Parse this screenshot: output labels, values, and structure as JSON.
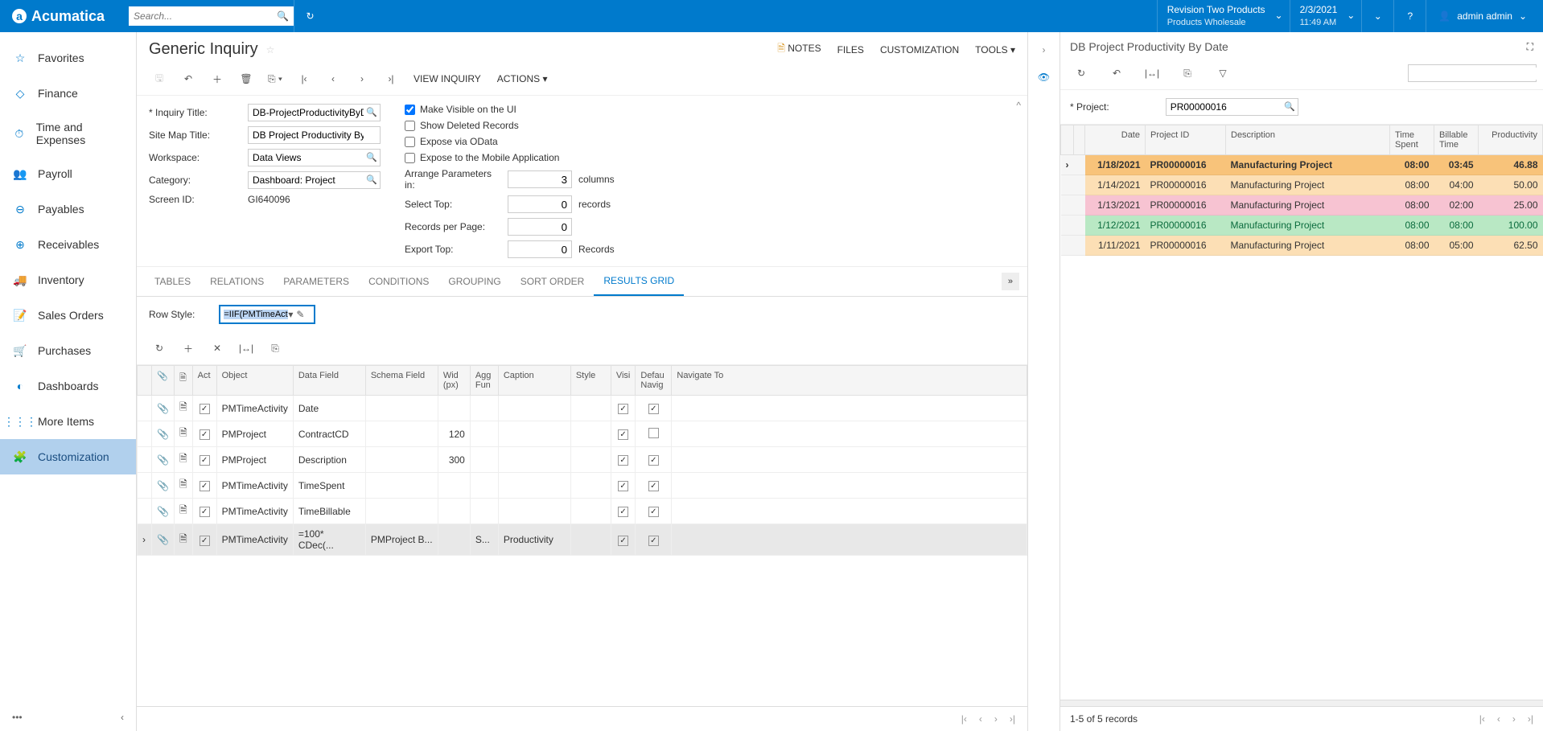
{
  "topbar": {
    "brand": "Acumatica",
    "search_placeholder": "Search...",
    "company_line1": "Revision Two Products",
    "company_line2": "Products Wholesale",
    "date": "2/3/2021",
    "time": "11:49 AM",
    "user": "admin admin"
  },
  "sidebar": {
    "items": [
      {
        "label": "Favorites",
        "icon": "star"
      },
      {
        "label": "Finance",
        "icon": "diamond"
      },
      {
        "label": "Time and Expenses",
        "icon": "stopwatch"
      },
      {
        "label": "Payroll",
        "icon": "people"
      },
      {
        "label": "Payables",
        "icon": "minus-circle"
      },
      {
        "label": "Receivables",
        "icon": "plus-circle"
      },
      {
        "label": "Inventory",
        "icon": "truck"
      },
      {
        "label": "Sales Orders",
        "icon": "note"
      },
      {
        "label": "Purchases",
        "icon": "cart"
      },
      {
        "label": "Dashboards",
        "icon": "gauge"
      },
      {
        "label": "More Items",
        "icon": "grid"
      },
      {
        "label": "Customization",
        "icon": "puzzle"
      }
    ]
  },
  "page": {
    "title": "Generic Inquiry",
    "actions": {
      "notes": "NOTES",
      "files": "FILES",
      "customization": "CUSTOMIZATION",
      "tools": "TOOLS"
    },
    "toolbar": {
      "viewinquiry": "VIEW INQUIRY",
      "actions": "ACTIONS"
    }
  },
  "form": {
    "inquiry_title_label": "Inquiry Title:",
    "inquiry_title": "DB-ProjectProductivityByDate",
    "sitemap_label": "Site Map Title:",
    "sitemap": "DB Project Productivity By Date",
    "workspace_label": "Workspace:",
    "workspace": "Data Views",
    "category_label": "Category:",
    "category": "Dashboard: Project",
    "screen_label": "Screen ID:",
    "screen": "GI640096",
    "chk_ui": "Make Visible on the UI",
    "chk_deleted": "Show Deleted Records",
    "chk_odata": "Expose via OData",
    "chk_mobile": "Expose to the Mobile Application",
    "arrange_label": "Arrange Parameters in:",
    "arrange_val": "3",
    "arrange_unit": "columns",
    "selecttop_label": "Select Top:",
    "selecttop_val": "0",
    "selecttop_unit": "records",
    "rpp_label": "Records per Page:",
    "rpp_val": "0",
    "export_label": "Export Top:",
    "export_val": "0",
    "export_unit": "Records"
  },
  "tabs": [
    "TABLES",
    "RELATIONS",
    "PARAMETERS",
    "CONDITIONS",
    "GROUPING",
    "SORT ORDER",
    "RESULTS GRID"
  ],
  "rowstyle": {
    "label": "Row Style:",
    "value": "=IIF(PMTimeActivi"
  },
  "grid": {
    "headers": {
      "act": "Act",
      "object": "Object",
      "datafield": "Data Field",
      "schema": "Schema Field",
      "width": "Wid (px)",
      "agg": "Agg Fun",
      "caption": "Caption",
      "style": "Style",
      "visi": "Visi",
      "default": "Defau Navig",
      "navigate": "Navigate To"
    },
    "rows": [
      {
        "act": true,
        "object": "PMTimeActivity",
        "datafield": "Date",
        "schema": "",
        "width": "",
        "agg": "",
        "caption": "",
        "style": "",
        "visi": true,
        "default": true
      },
      {
        "act": true,
        "object": "PMProject",
        "datafield": "ContractCD",
        "schema": "",
        "width": "120",
        "agg": "",
        "caption": "",
        "style": "",
        "visi": true,
        "default": false
      },
      {
        "act": true,
        "object": "PMProject",
        "datafield": "Description",
        "schema": "",
        "width": "300",
        "agg": "",
        "caption": "",
        "style": "",
        "visi": true,
        "default": true
      },
      {
        "act": true,
        "object": "PMTimeActivity",
        "datafield": "TimeSpent",
        "schema": "",
        "width": "",
        "agg": "",
        "caption": "",
        "style": "",
        "visi": true,
        "default": true
      },
      {
        "act": true,
        "object": "PMTimeActivity",
        "datafield": "TimeBillable",
        "schema": "",
        "width": "",
        "agg": "",
        "caption": "",
        "style": "",
        "visi": true,
        "default": true
      },
      {
        "act": true,
        "object": "PMTimeActivity",
        "datafield": "=100* CDec(...",
        "schema": "PMProject B...",
        "width": "",
        "agg": "S...",
        "caption": "Productivity",
        "style": "",
        "visi": true,
        "default": true
      }
    ]
  },
  "right": {
    "title": "DB Project Productivity By Date",
    "project_label": "Project:",
    "project": "PR00000016",
    "headers": {
      "date": "Date",
      "pid": "Project ID",
      "desc": "Description",
      "spent": "Time Spent",
      "bill": "Billable Time",
      "prod": "Productivity"
    },
    "rows": [
      {
        "date": "1/18/2021",
        "pid": "PR00000016",
        "desc": "Manufacturing Project",
        "spent": "08:00",
        "bill": "03:45",
        "prod": "46.88",
        "cls": "r-row-orange"
      },
      {
        "date": "1/14/2021",
        "pid": "PR00000016",
        "desc": "Manufacturing Project",
        "spent": "08:00",
        "bill": "04:00",
        "prod": "50.00",
        "cls": "r-row-lightorange"
      },
      {
        "date": "1/13/2021",
        "pid": "PR00000016",
        "desc": "Manufacturing Project",
        "spent": "08:00",
        "bill": "02:00",
        "prod": "25.00",
        "cls": "r-row-pink"
      },
      {
        "date": "1/12/2021",
        "pid": "PR00000016",
        "desc": "Manufacturing Project",
        "spent": "08:00",
        "bill": "08:00",
        "prod": "100.00",
        "cls": "r-row-green2"
      },
      {
        "date": "1/11/2021",
        "pid": "PR00000016",
        "desc": "Manufacturing Project",
        "spent": "08:00",
        "bill": "05:00",
        "prod": "62.50",
        "cls": "r-row-lightorange"
      }
    ],
    "pager": "1-5 of 5 records"
  }
}
